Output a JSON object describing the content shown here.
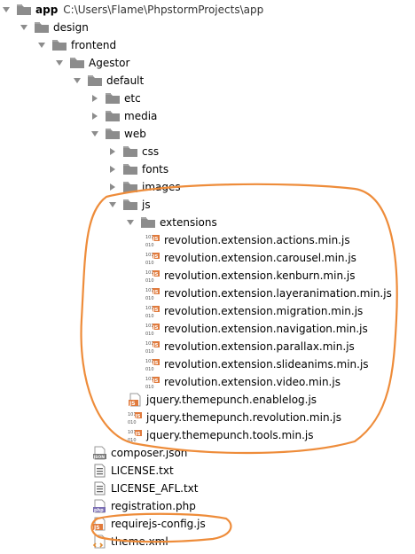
{
  "root": {
    "label": "app",
    "path": "C:\\Users\\Flame\\PhpstormProjects\\app"
  },
  "tree": [
    {
      "label": "design",
      "depth": 1,
      "kind": "folder",
      "state": "open"
    },
    {
      "label": "frontend",
      "depth": 2,
      "kind": "folder",
      "state": "open"
    },
    {
      "label": "Agestor",
      "depth": 3,
      "kind": "folder",
      "state": "open"
    },
    {
      "label": "default",
      "depth": 4,
      "kind": "folder",
      "state": "open"
    },
    {
      "label": "etc",
      "depth": 5,
      "kind": "folder",
      "state": "closed"
    },
    {
      "label": "media",
      "depth": 5,
      "kind": "folder",
      "state": "closed"
    },
    {
      "label": "web",
      "depth": 5,
      "kind": "folder",
      "state": "open"
    },
    {
      "label": "css",
      "depth": 6,
      "kind": "folder",
      "state": "closed"
    },
    {
      "label": "fonts",
      "depth": 6,
      "kind": "folder",
      "state": "closed"
    },
    {
      "label": "images",
      "depth": 6,
      "kind": "folder",
      "state": "closed"
    },
    {
      "label": "js",
      "depth": 6,
      "kind": "folder",
      "state": "open"
    },
    {
      "label": "extensions",
      "depth": 7,
      "kind": "folder",
      "state": "open"
    },
    {
      "label": "revolution.extension.actions.min.js",
      "depth": 8,
      "kind": "minjs"
    },
    {
      "label": "revolution.extension.carousel.min.js",
      "depth": 8,
      "kind": "minjs"
    },
    {
      "label": "revolution.extension.kenburn.min.js",
      "depth": 8,
      "kind": "minjs"
    },
    {
      "label": "revolution.extension.layeranimation.min.js",
      "depth": 8,
      "kind": "minjs"
    },
    {
      "label": "revolution.extension.migration.min.js",
      "depth": 8,
      "kind": "minjs"
    },
    {
      "label": "revolution.extension.navigation.min.js",
      "depth": 8,
      "kind": "minjs"
    },
    {
      "label": "revolution.extension.parallax.min.js",
      "depth": 8,
      "kind": "minjs"
    },
    {
      "label": "revolution.extension.slideanims.min.js",
      "depth": 8,
      "kind": "minjs"
    },
    {
      "label": "revolution.extension.video.min.js",
      "depth": 8,
      "kind": "minjs"
    },
    {
      "label": "jquery.themepunch.enablelog.js",
      "depth": 7,
      "kind": "js"
    },
    {
      "label": "jquery.themepunch.revolution.min.js",
      "depth": 7,
      "kind": "minjs"
    },
    {
      "label": "jquery.themepunch.tools.min.js",
      "depth": 7,
      "kind": "minjs"
    },
    {
      "label": "composer.json",
      "depth": 5,
      "kind": "json"
    },
    {
      "label": "LICENSE.txt",
      "depth": 5,
      "kind": "txt"
    },
    {
      "label": "LICENSE_AFL.txt",
      "depth": 5,
      "kind": "txt"
    },
    {
      "label": "registration.php",
      "depth": 5,
      "kind": "php"
    },
    {
      "label": "requirejs-config.js",
      "depth": 5,
      "kind": "js"
    },
    {
      "label": "theme.xml",
      "depth": 5,
      "kind": "xml"
    }
  ],
  "icon_text": {
    "minjs_top": "101",
    "minjs_mid": "JS",
    "minjs_bottom": "010",
    "js": "JS",
    "json": "JSON",
    "php": "php"
  },
  "colors": {
    "folder": "#8c8c8c",
    "folder_tab": "#a3a3a3",
    "arrow": "#8c8c8c",
    "js_orange": "#e07a3c",
    "php_purple": "#7b6fb3",
    "xml_orange": "#e08a2e",
    "annotation": "#ee8c3a"
  },
  "icons": {
    "folder": "folder-icon",
    "open": "triangle-down-icon",
    "closed": "triangle-right-icon"
  }
}
